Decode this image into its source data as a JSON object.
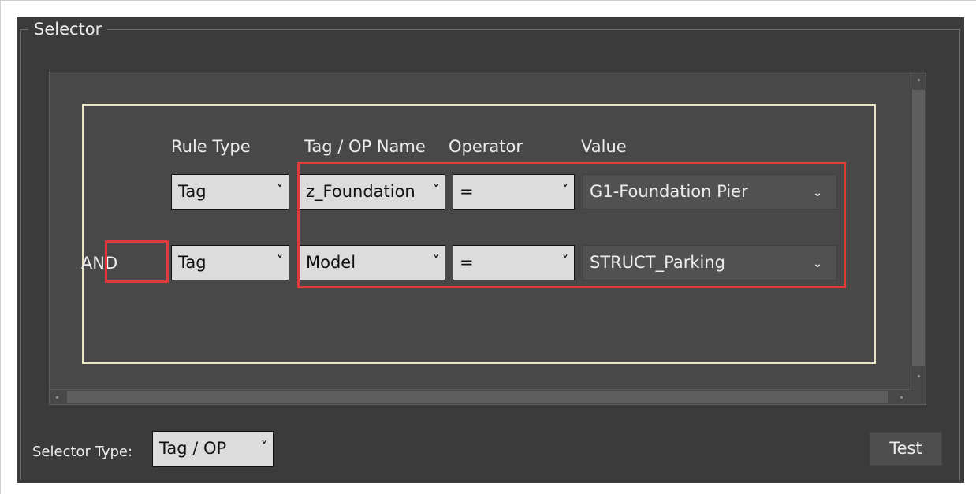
{
  "group_title": "Selector",
  "columns": {
    "rule_type": "Rule Type",
    "tag_op_name": "Tag / OP Name",
    "operator": "Operator",
    "value": "Value"
  },
  "rules": [
    {
      "connector": "",
      "rule_type": "Tag",
      "tag_op_name": "z_Foundation",
      "operator": "=",
      "value": "G1-Foundation Pier"
    },
    {
      "connector": "AND",
      "rule_type": "Tag",
      "tag_op_name": "Model",
      "operator": "=",
      "value": "STRUCT_Parking"
    }
  ],
  "footer": {
    "selector_type_label": "Selector Type:",
    "selector_type_value": "Tag / OP",
    "test_label": "Test"
  },
  "icons": {
    "dropdown": "chevron-down-icon"
  },
  "colors": {
    "highlight": "#e0393a",
    "rules_border": "#e8e4c2",
    "panel_bg": "#3b3b3b"
  }
}
